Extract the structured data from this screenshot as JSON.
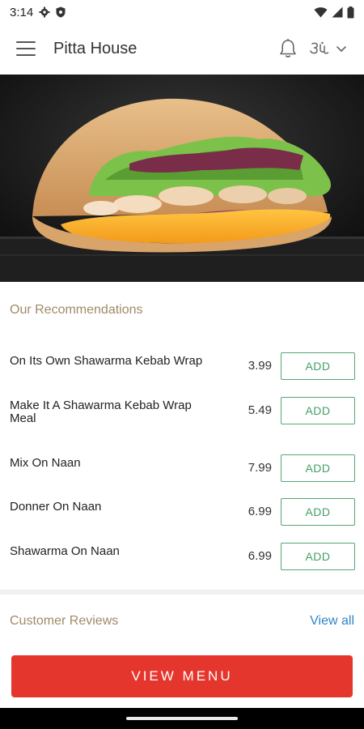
{
  "status_bar": {
    "time": "3:14",
    "icons": [
      "gear-icon",
      "shield-icon",
      "wifi-icon",
      "signal-icon",
      "battery-icon"
    ]
  },
  "app_bar": {
    "title": "Pitta House",
    "icons": [
      "menu-icon",
      "bell-icon",
      "language-icon",
      "chevron-down-icon"
    ]
  },
  "hero": {
    "image": "shawarma-wrap-photo"
  },
  "recommendations": {
    "title": "Our Recommendations",
    "add_label": "ADD",
    "items": [
      {
        "name": "On Its Own Shawarma Kebab Wrap",
        "price": "3.99"
      },
      {
        "name": "Make It A Shawarma Kebab Wrap Meal",
        "price": "5.49"
      },
      {
        "name": "Mix On Naan",
        "price": "7.99"
      },
      {
        "name": "Donner On Naan",
        "price": "6.99"
      },
      {
        "name": "Shawarma On Naan",
        "price": "6.99"
      }
    ]
  },
  "reviews": {
    "title": "Customer Reviews",
    "view_all": "View all"
  },
  "cta": {
    "label": "VIEW MENU"
  },
  "colors": {
    "accent_gold": "#a08a66",
    "add_green": "#43a065",
    "link_blue": "#2f84c7",
    "cta_red": "#e5362d"
  }
}
